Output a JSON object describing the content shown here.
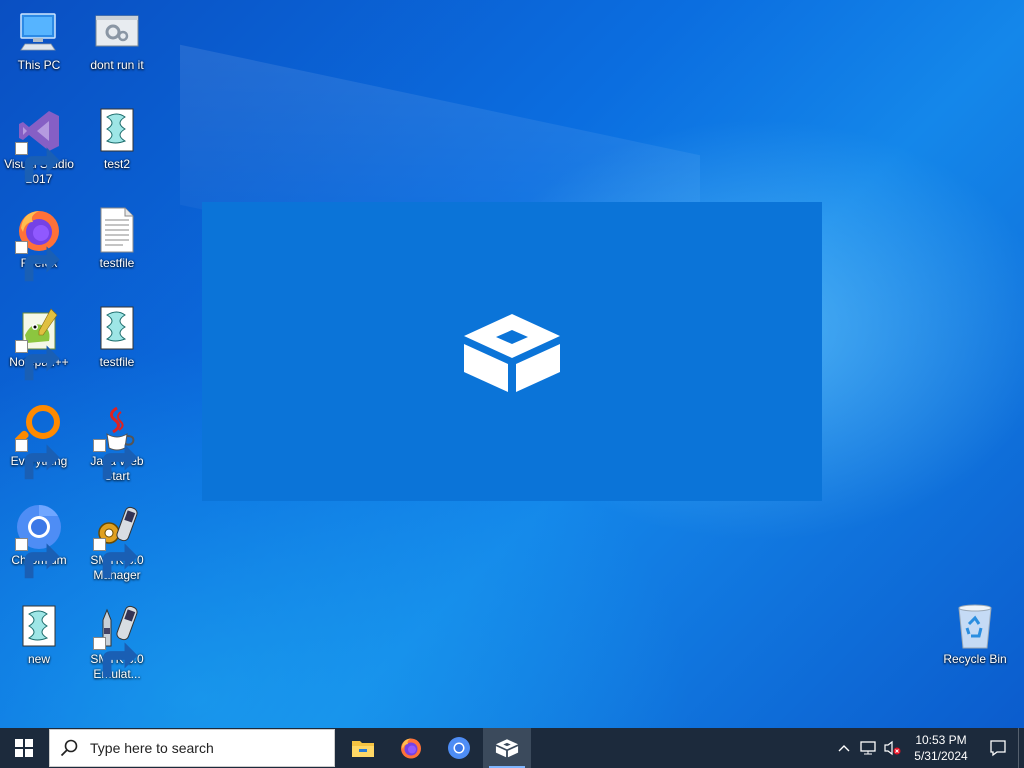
{
  "desktop_icons": [
    {
      "label": "This PC",
      "icon": "computer-icon"
    },
    {
      "label": "dont run it",
      "icon": "gear-window-icon"
    },
    {
      "label": "Visual Studio 2017",
      "icon": "visual-studio-icon"
    },
    {
      "label": "test2",
      "icon": "script-icon"
    },
    {
      "label": "Firefox",
      "icon": "firefox-icon"
    },
    {
      "label": "testfile",
      "icon": "text-file-icon"
    },
    {
      "label": "Notepad++",
      "icon": "notepadpp-icon"
    },
    {
      "label": "testfile",
      "icon": "script-icon"
    },
    {
      "label": "Everything",
      "icon": "everything-search-icon"
    },
    {
      "label": "Java Web Start",
      "icon": "java-icon"
    },
    {
      "label": "Chromium",
      "icon": "chromium-icon"
    },
    {
      "label": "SMTK 3.0 Manager",
      "icon": "smtk-manager-icon"
    },
    {
      "label": "new",
      "icon": "script-icon"
    },
    {
      "label": "SMTK 3.0 Emulat...",
      "icon": "smtk-emulator-icon"
    },
    {
      "label": "Recycle Bin",
      "icon": "recycle-bin-icon"
    }
  ],
  "splash": {
    "icon": "sandbox-box-icon",
    "color": "#0b74d8"
  },
  "taskbar": {
    "search_placeholder": "Type here to search",
    "apps": [
      {
        "name": "file-explorer-icon"
      },
      {
        "name": "firefox-icon"
      },
      {
        "name": "chromium-icon"
      },
      {
        "name": "sandbox-icon",
        "active": true
      }
    ],
    "clock_time": "10:53 PM",
    "clock_date": "5/31/2024"
  },
  "colors": {
    "taskbar": "#1c2a3c",
    "desktop_accent": "#0b6ee0"
  }
}
